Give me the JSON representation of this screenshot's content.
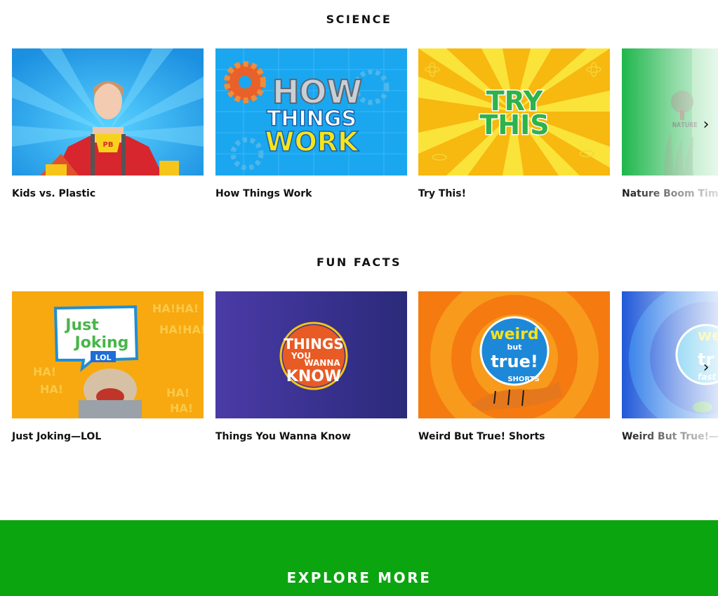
{
  "sections": [
    {
      "title": "SCIENCE",
      "items": [
        {
          "label": "Kids vs. Plastic",
          "thumb_badge": "PB"
        },
        {
          "label": "How Things Work",
          "thumb_text": [
            "HOW",
            "THINGS",
            "WORK"
          ]
        },
        {
          "label": "Try This!",
          "thumb_text": [
            "TRY",
            "THIS"
          ]
        },
        {
          "label": "Nature Boom Time V",
          "thumb_text": "NATURE"
        }
      ]
    },
    {
      "title": "FUN FACTS",
      "items": [
        {
          "label": "Just Joking—LOL",
          "thumb_text": [
            "Just",
            "Joking",
            "LOL"
          ]
        },
        {
          "label": "Things You Wanna Know",
          "thumb_text": [
            "THINGS",
            "YOU",
            "WANNA",
            "KNOW"
          ]
        },
        {
          "label": "Weird But True! Shorts",
          "thumb_text": [
            "weird",
            "but",
            "true!",
            "SHORTS"
          ]
        },
        {
          "label": "Weird But True!—Fas",
          "thumb_text": [
            "we",
            "tr",
            "fast"
          ]
        }
      ]
    }
  ],
  "next_icon": "chevron-right-icon",
  "footer": {
    "label": "EXPLORE MORE",
    "color": "#0ba50f"
  }
}
